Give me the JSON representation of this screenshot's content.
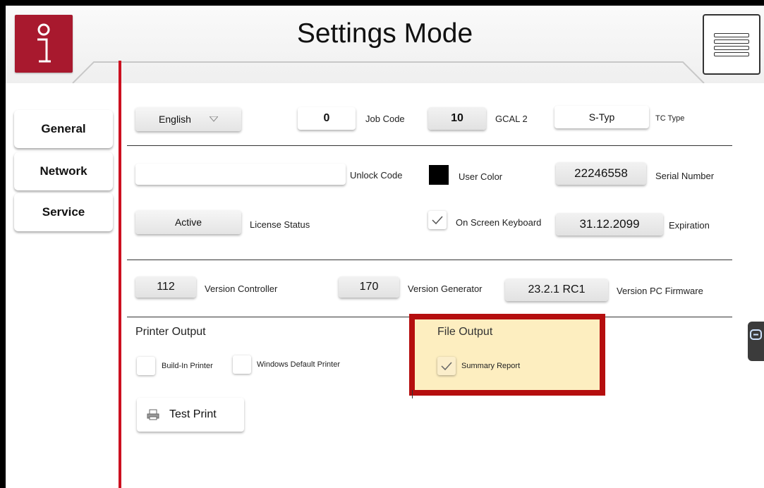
{
  "header": {
    "title": "Settings Mode"
  },
  "sidebar": {
    "items": [
      {
        "label": "General"
      },
      {
        "label": "Network"
      },
      {
        "label": "Service"
      }
    ]
  },
  "row1": {
    "language": "English",
    "job_code_value": "0",
    "job_code_label": "Job Code",
    "gcal_value": "10",
    "gcal_label": "GCAL 2",
    "tc_type_value": "S-Typ",
    "tc_type_label": "TC Type"
  },
  "row2": {
    "unlock_code_value": "",
    "unlock_code_label": "Unlock Code",
    "user_color_label": "User Color",
    "user_color": "#000000",
    "serial_value": "22246558",
    "serial_label": "Serial Number"
  },
  "row3": {
    "license_value": "Active",
    "license_label": "License Status",
    "keyboard_label": "On Screen Keyboard",
    "keyboard_checked": true,
    "expiration_value": "31.12.2099",
    "expiration_label": "Expiration"
  },
  "versions": {
    "controller_value": "112",
    "controller_label": "Version Controller",
    "generator_value": "170",
    "generator_label": "Version Generator",
    "firmware_value": "23.2.1 RC1",
    "firmware_label": "Version PC Firmware"
  },
  "printer_output": {
    "title": "Printer Output",
    "build_in_label": "Build-In Printer",
    "build_in_checked": false,
    "windows_default_label": "Windows Default Printer",
    "windows_default_checked": false,
    "test_print_label": "Test Print"
  },
  "file_output": {
    "title": "File Output",
    "summary_label": "Summary Report",
    "summary_checked": true
  },
  "colors": {
    "accent": "#cc1020",
    "brand_red": "#a8192e",
    "highlight": "#b50e0e",
    "highlight_fill": "#fdeec0"
  }
}
